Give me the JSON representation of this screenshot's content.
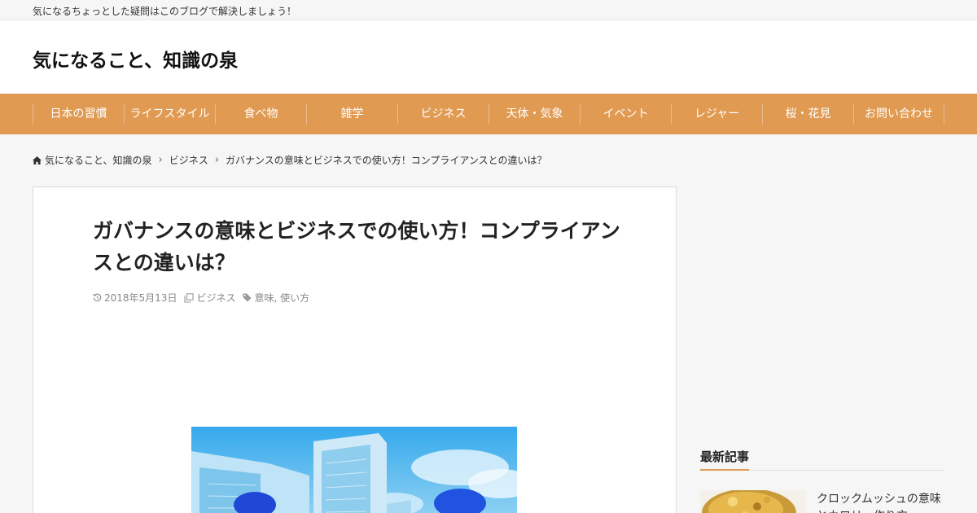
{
  "site": {
    "tagline": "気になるちょっとした疑問はこのブログで解決しましょう！",
    "title": "気になること、知識の泉"
  },
  "nav": [
    {
      "label": "日本の習慣"
    },
    {
      "label": "ライフスタイル"
    },
    {
      "label": "食べ物"
    },
    {
      "label": "雑学"
    },
    {
      "label": "ビジネス"
    },
    {
      "label": "天体・気象"
    },
    {
      "label": "イベント"
    },
    {
      "label": "レジャー"
    },
    {
      "label": "桜・花見"
    },
    {
      "label": "お問い合わせ"
    }
  ],
  "breadcrumb": {
    "home": "気になること、知識の泉",
    "category": "ビジネス",
    "current": "ガバナンスの意味とビジネスでの使い方！コンプライアンスとの違いは？"
  },
  "article": {
    "title": "ガバナンスの意味とビジネスでの使い方！コンプライアンスとの違いは？",
    "date": "2018年5月13日",
    "category": "ビジネス",
    "tags": "意味, 使い方"
  },
  "sidebar": {
    "recent_heading": "最新記事",
    "recent_posts": [
      {
        "title": "クロックムッシュの意味とカロリー作り方"
      }
    ]
  },
  "colors": {
    "accent": "#e09a52",
    "background": "#f6f6f6"
  }
}
